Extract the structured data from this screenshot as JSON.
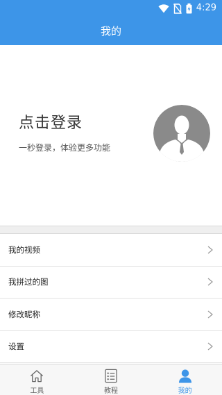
{
  "status_bar": {
    "time": "4:29",
    "icons": [
      "wifi-icon",
      "no-sim-icon",
      "battery-charging-icon"
    ]
  },
  "app_bar": {
    "title": "我的"
  },
  "profile": {
    "login_title": "点击登录",
    "login_subtitle": "一秒登录，体验更多功能",
    "avatar_icon": "user-avatar-icon"
  },
  "menu": {
    "items": [
      {
        "label": "我的视频",
        "icon": "chevron-right-icon"
      },
      {
        "label": "我拼过的图",
        "icon": "chevron-right-icon"
      },
      {
        "label": "修改昵称",
        "icon": "chevron-right-icon"
      },
      {
        "label": "设置",
        "icon": "chevron-right-icon"
      }
    ]
  },
  "tab_bar": {
    "tabs": [
      {
        "label": "工具",
        "icon": "home-icon",
        "active": false
      },
      {
        "label": "教程",
        "icon": "list-icon",
        "active": false
      },
      {
        "label": "我的",
        "icon": "person-icon",
        "active": true
      }
    ]
  },
  "colors": {
    "primary": "#3d95e8",
    "tab_inactive": "#666666",
    "avatar_bg": "#8a8a8a"
  }
}
